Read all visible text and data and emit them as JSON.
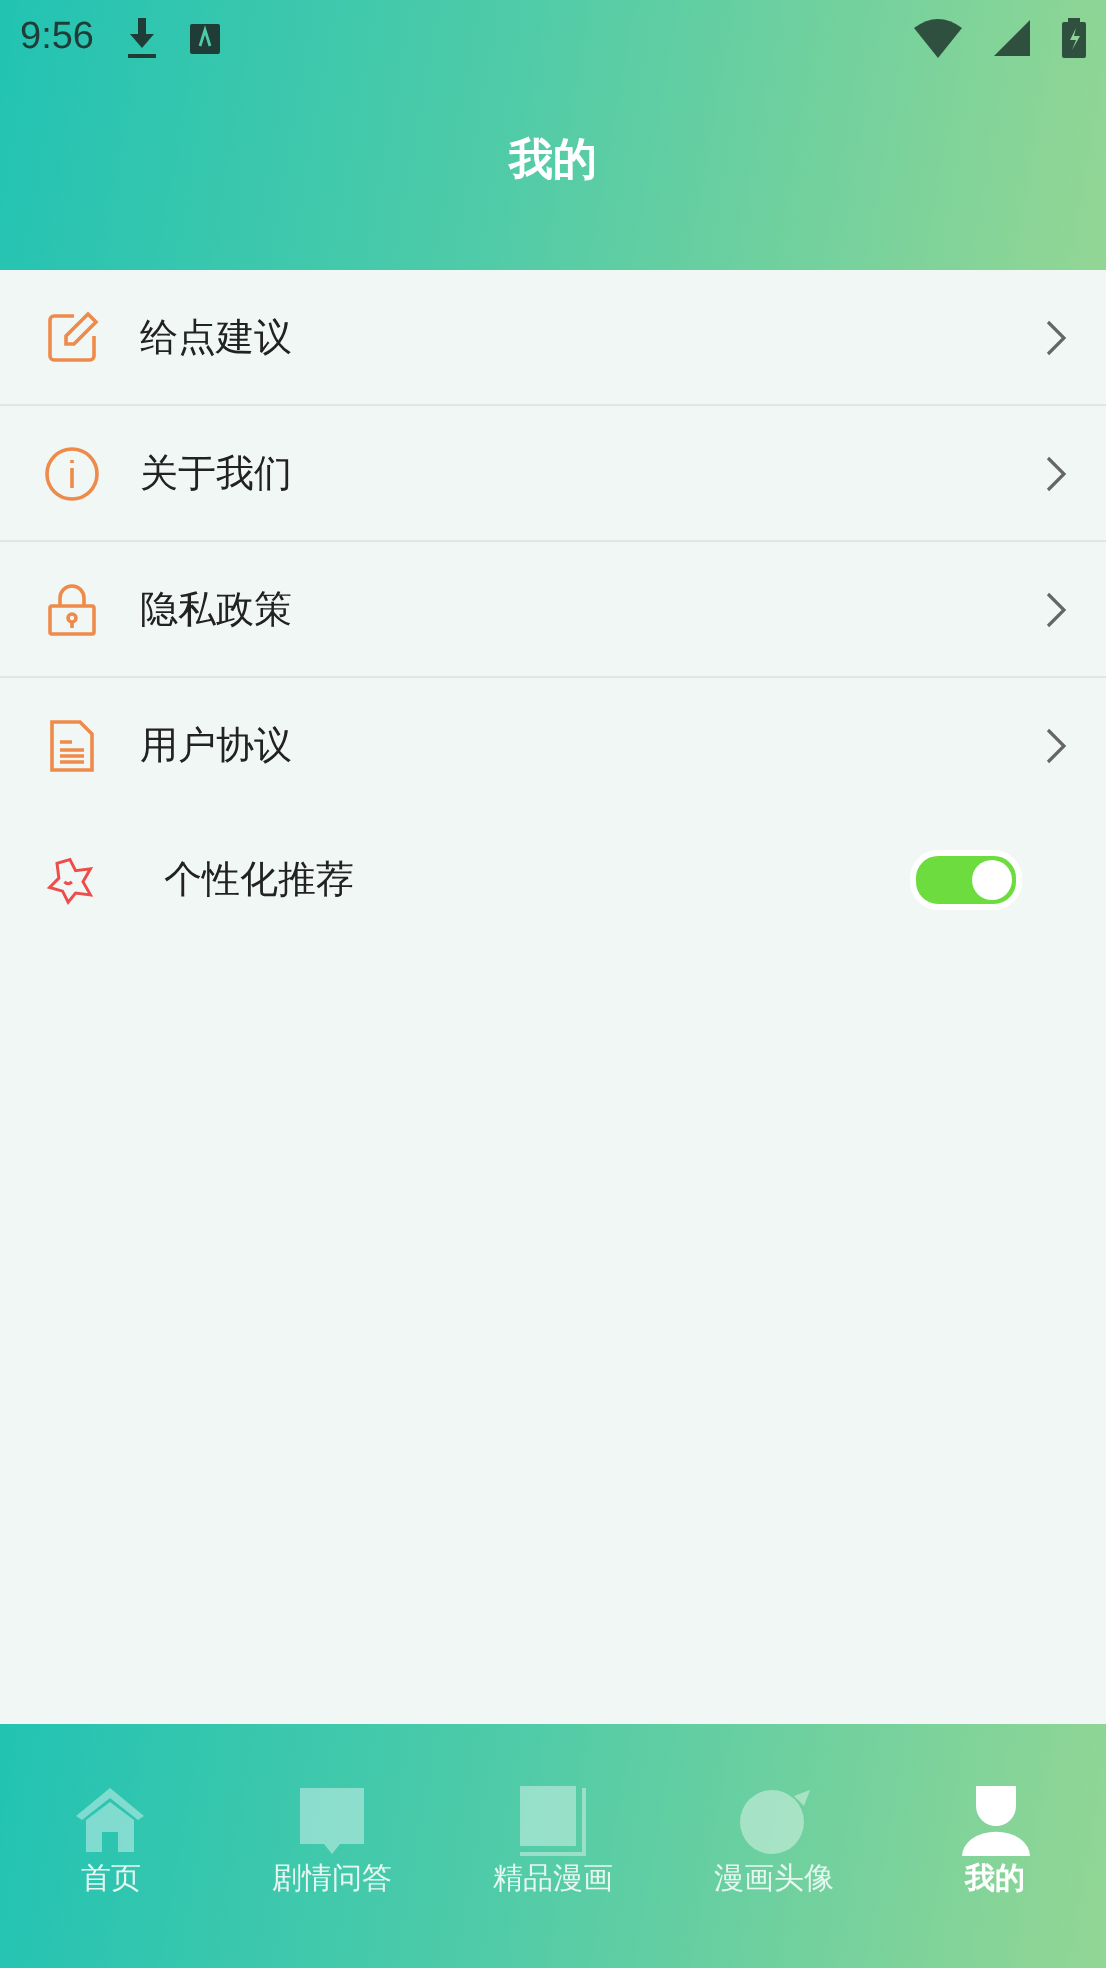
{
  "status_bar": {
    "time": "9:56"
  },
  "header": {
    "title": "我的"
  },
  "menu": [
    {
      "kind": "link",
      "label": "给点建议"
    },
    {
      "kind": "link",
      "label": "关于我们"
    },
    {
      "kind": "link",
      "label": "隐私政策"
    },
    {
      "kind": "link",
      "label": "用户协议"
    },
    {
      "kind": "toggle",
      "label": "个性化推荐",
      "on": true
    }
  ],
  "tabs": [
    {
      "label": "首页",
      "selected": false
    },
    {
      "label": "剧情问答",
      "selected": false
    },
    {
      "label": "精品漫画",
      "selected": false
    },
    {
      "label": "漫画头像",
      "selected": false
    },
    {
      "label": "我的",
      "selected": true
    }
  ]
}
